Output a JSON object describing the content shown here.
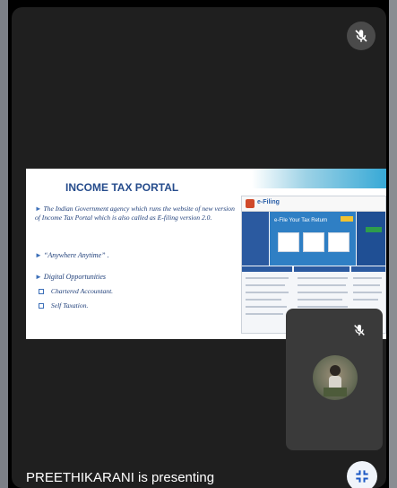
{
  "slide": {
    "title": "INCOME TAX PORTAL",
    "paragraph": "The Indian Government agency which runs the website of new version of Income Tax Portal which is also called as E-filing version 2.0.",
    "quote": "“Anywhere Anytime” .",
    "digital": "Digital Opportunities",
    "sub_items": [
      "Chartered Accountant.",
      "Self Taxation."
    ],
    "screenshot": {
      "site_name": "e-Filing",
      "hero_text": "e-File Your Tax Return"
    }
  },
  "presenter": {
    "status": "PREETHIKARANI is presenting"
  },
  "icons": {
    "main_mic": "mic-off-icon",
    "pip_mic": "mic-off-icon",
    "minimize": "minimize-icon"
  },
  "colors": {
    "title": "#264c8c",
    "text": "#1d3d78",
    "stage_bg": "#1f1f1f",
    "tile_bg": "#3a3a3a"
  }
}
